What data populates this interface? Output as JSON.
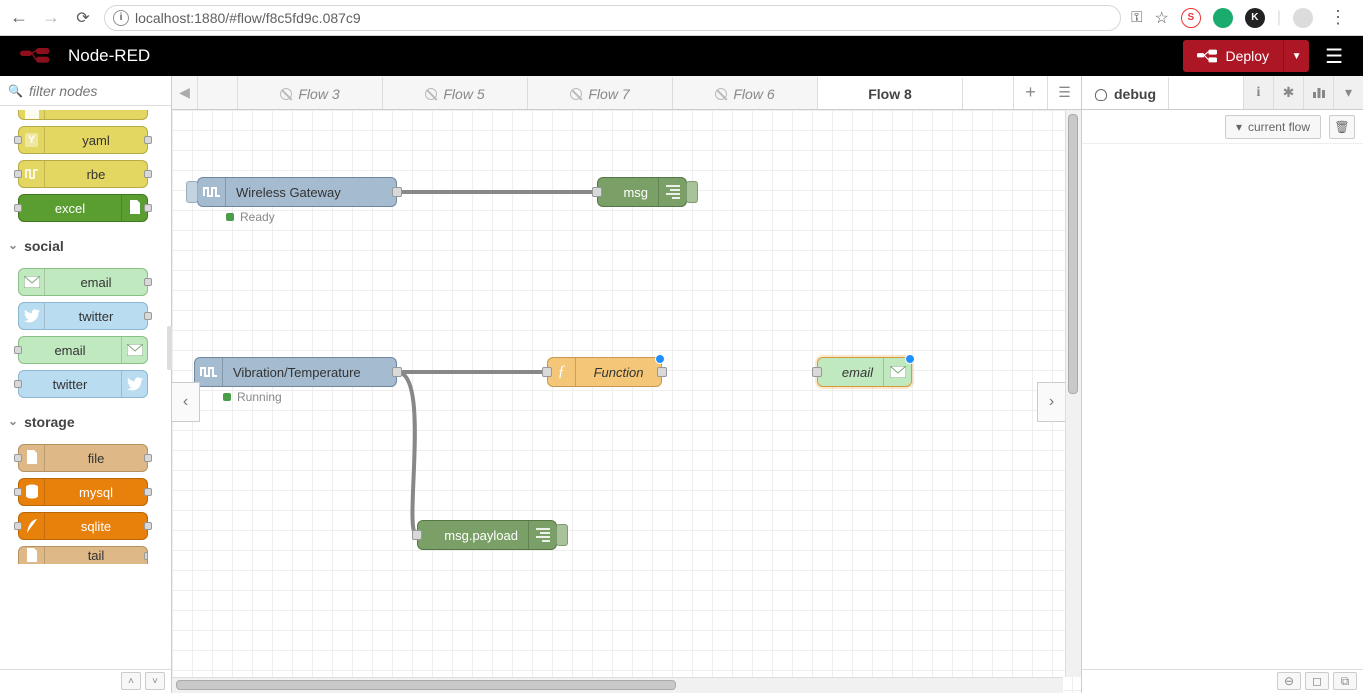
{
  "browser": {
    "url": "localhost:1880/#flow/f8c5fd9c.087c9"
  },
  "header": {
    "title": "Node-RED",
    "deploy_label": "Deploy"
  },
  "palette": {
    "filter_placeholder": "filter nodes",
    "items": [
      {
        "label": "",
        "style": "part"
      },
      {
        "label": "yaml",
        "style": "yaml"
      },
      {
        "label": "rbe",
        "style": "rbe"
      },
      {
        "label": "excel",
        "style": "excel"
      }
    ],
    "cat_social": "social",
    "social": [
      {
        "label": "email",
        "style": "email-in"
      },
      {
        "label": "twitter",
        "style": "twitter-in"
      },
      {
        "label": "email",
        "style": "email-out"
      },
      {
        "label": "twitter",
        "style": "twitter-out"
      }
    ],
    "cat_storage": "storage",
    "storage": [
      {
        "label": "file",
        "style": "file"
      },
      {
        "label": "mysql",
        "style": "mysql"
      },
      {
        "label": "sqlite",
        "style": "sqlite"
      },
      {
        "label": "tail",
        "style": "tail"
      }
    ]
  },
  "tabs": [
    "Flow 3",
    "Flow 5",
    "Flow 7",
    "Flow 6",
    "Flow 8"
  ],
  "canvas": {
    "gateway": {
      "label": "Wireless Gateway",
      "status": "Ready"
    },
    "msg": {
      "label": "msg"
    },
    "vibtemp": {
      "label": "Vibration/Temperature",
      "status": "Running"
    },
    "func": {
      "label": "Function"
    },
    "email": {
      "label": "email"
    },
    "payload": {
      "label": "msg.payload"
    }
  },
  "sidebar": {
    "title": "debug",
    "filter": "current flow"
  }
}
